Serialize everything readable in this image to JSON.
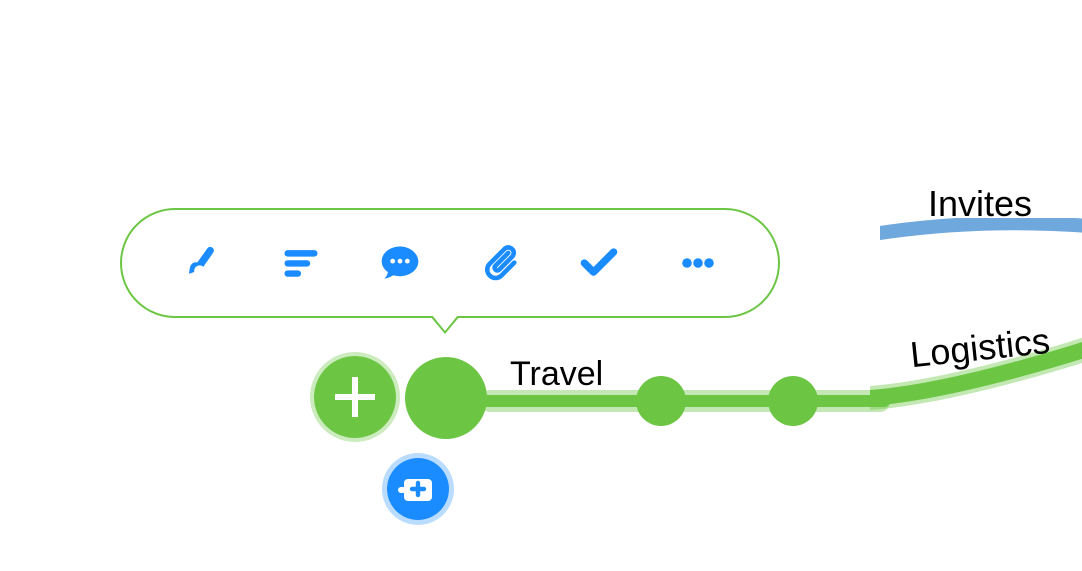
{
  "toolbar": {
    "tools": [
      {
        "name": "style-icon",
        "icon": "brush"
      },
      {
        "name": "notes-icon",
        "icon": "lines"
      },
      {
        "name": "comment-icon",
        "icon": "chat"
      },
      {
        "name": "attach-icon",
        "icon": "paperclip"
      },
      {
        "name": "task-icon",
        "icon": "check"
      },
      {
        "name": "more-icon",
        "icon": "dots"
      }
    ]
  },
  "nodes": {
    "selected_label": "Travel",
    "sibling_labels": [
      "Logistics",
      "Invites"
    ]
  },
  "labels": {
    "travel": "Travel",
    "logistics": "Logistics",
    "invites": "Invites"
  },
  "colors": {
    "green": "#6cc644",
    "blue": "#1a8cff",
    "invites_blue": "#6fa8dc"
  }
}
